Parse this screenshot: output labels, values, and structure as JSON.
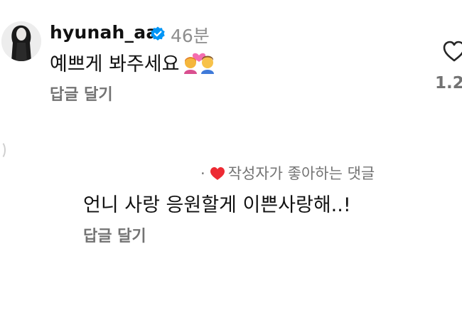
{
  "comment": {
    "username": "hyunah_aa",
    "time": "46분",
    "text": "예쁘게 봐주세요",
    "emoji": "couple-with-heart-emoji",
    "reply_label": "답글 달기",
    "like_count": "1.2"
  },
  "reply": {
    "author_liked_label": "작성자가 좋아하는 댓글",
    "separator": "·",
    "text": "언니 사랑 응원할게 이쁜사랑해..!",
    "reply_label": "답글 달기"
  },
  "colors": {
    "secondary_text": "#737373",
    "verified_blue": "#0095f6",
    "heart_red": "#ed2a33"
  },
  "icons": {
    "like": "heart-outline-icon",
    "verified": "verified-badge-icon",
    "author_liked": "red-heart-icon"
  }
}
